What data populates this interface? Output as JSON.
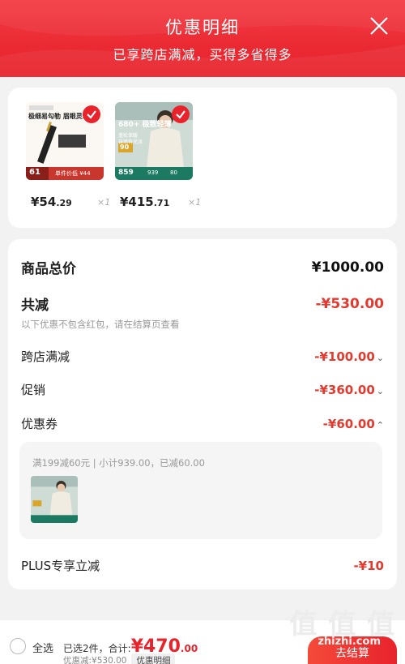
{
  "header": {
    "title": "优惠明细",
    "subtitle": "已享跨店满减，买得多省得多",
    "close_icon": "close-icon"
  },
  "products": [
    {
      "name": "eyeliner-product",
      "price_main": "¥54",
      "price_decimal": ".29",
      "qty": "×1",
      "thumb_text_top": "极细易勾勒 眉眼灵动",
      "thumb_price": "61",
      "thumb_bottom": "单件价低 ¥44",
      "selected": true
    },
    {
      "name": "down-jacket-product",
      "price_main": "¥415",
      "price_decimal": ".71",
      "qty": "×1",
      "thumb_text_top": "680+ 极致轻薄",
      "thumb_mid": "蓬松保暖 自然有光泽",
      "thumb_badge": "90",
      "thumb_price": "859",
      "thumb_p2": "939",
      "thumb_p3": "80",
      "selected": true
    }
  ],
  "summary": {
    "total_label": "商品总价",
    "total_value": "¥1000.00",
    "reduce_label": "共减",
    "reduce_value": "-¥530.00",
    "note": "以下优惠不包含红包，请在结算页查看",
    "items": [
      {
        "label": "跨店满减",
        "value": "-¥100.00",
        "chevron": "chevron-down-icon"
      },
      {
        "label": "促销",
        "value": "-¥360.00",
        "chevron": "chevron-down-icon"
      },
      {
        "label": "优惠券",
        "value": "-¥60.00",
        "chevron": "chevron-up-icon"
      }
    ],
    "coupon_detail": "满199减60元 | 小计939.00，已减60.00",
    "plus_label": "PLUS专享立减",
    "plus_value": "-¥10"
  },
  "bottom": {
    "select_all": "全选",
    "chosen_text": "已选2件，合计:",
    "total_main": "¥470",
    "total_decimal": ".00",
    "saved": "优惠减:¥530.00",
    "detail_tag": "优惠明细",
    "checkout": "去结算"
  },
  "watermark": {
    "main": "值 值 值",
    "sub": "zhizhi.com"
  },
  "colors": {
    "accent": "#e8232c",
    "discount": "#e23a2e"
  }
}
